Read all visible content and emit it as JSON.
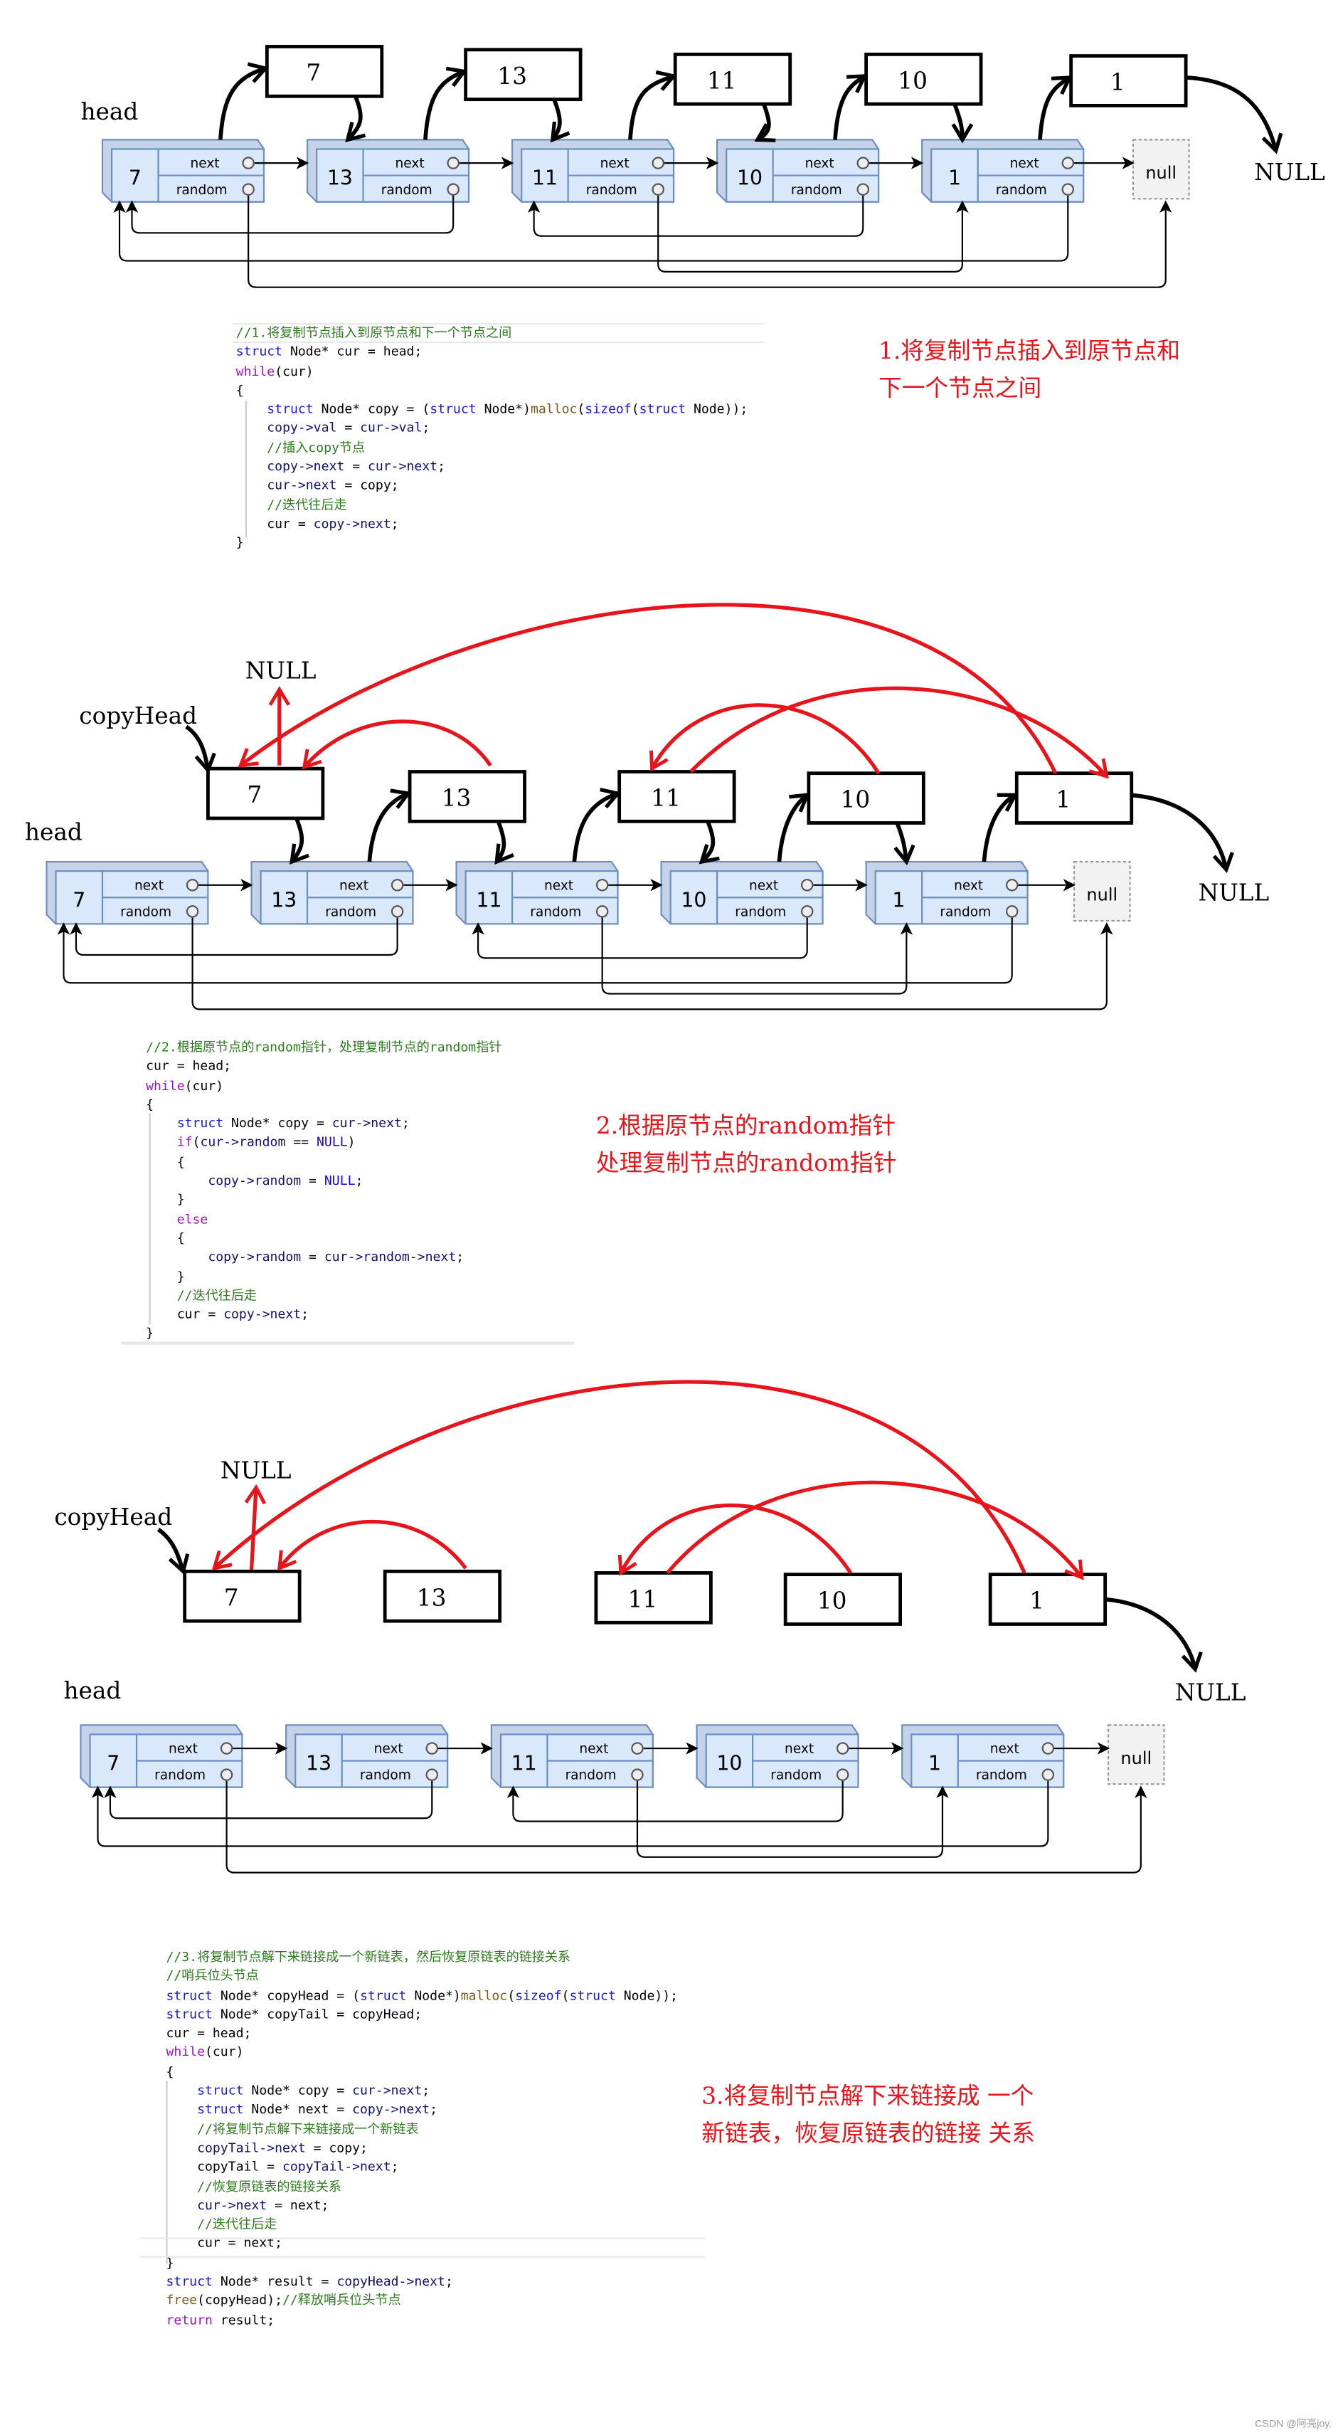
{
  "diagrams": [
    {
      "labels": {
        "head": "head",
        "null_right": "NULL",
        "null_box": "null"
      },
      "nodes": [
        "7",
        "13",
        "11",
        "10",
        "1"
      ],
      "copies": [
        "7",
        "13",
        "11",
        "10",
        "1"
      ],
      "fields": {
        "next": "next",
        "random": "random"
      }
    },
    {
      "labels": {
        "head": "head",
        "copy_head": "copyHead",
        "null_top": "NULL",
        "null_right": "NULL",
        "null_box": "null"
      },
      "nodes": [
        "7",
        "13",
        "11",
        "10",
        "1"
      ],
      "copies": [
        "7",
        "13",
        "11",
        "10",
        "1"
      ],
      "fields": {
        "next": "next",
        "random": "random"
      }
    },
    {
      "labels": {
        "head": "head",
        "copy_head": "copyHead",
        "null_top": "NULL",
        "null_right": "NULL",
        "null_box": "null"
      },
      "nodes": [
        "7",
        "13",
        "11",
        "10",
        "1"
      ],
      "copies": [
        "7",
        "13",
        "11",
        "10",
        "1"
      ],
      "fields": {
        "next": "next",
        "random": "random"
      }
    }
  ],
  "colors": {
    "node_fill": "#dae8fc",
    "node_stroke": "#6c8ebf",
    "red_arrow": "#e8141c",
    "note": "#e8141c"
  },
  "code_blocks": [
    [
      [
        [
          "cm",
          "//1.将复制节点插入到原节点和下一个节点之间"
        ]
      ],
      [
        [
          "k",
          "struct"
        ],
        [
          "n",
          " Node* cur = head;"
        ]
      ],
      [
        [
          "p",
          "while"
        ],
        [
          "n",
          "(cur)"
        ]
      ],
      [
        [
          "n",
          "{"
        ]
      ],
      [
        [
          "n",
          "    "
        ],
        [
          "k",
          "struct"
        ],
        [
          "n",
          " Node* copy = ("
        ],
        [
          "k",
          "struct"
        ],
        [
          "n",
          " Node*)"
        ],
        [
          "f",
          "malloc"
        ],
        [
          "n",
          "("
        ],
        [
          "k",
          "sizeof"
        ],
        [
          "n",
          "("
        ],
        [
          "k",
          "struct"
        ],
        [
          "n",
          " Node));"
        ]
      ],
      [
        [
          "n",
          "    "
        ],
        [
          "v",
          "copy->val"
        ],
        [
          "n",
          " = "
        ],
        [
          "v",
          "cur->val"
        ],
        [
          "n",
          ";"
        ]
      ],
      [
        [
          "n",
          "    "
        ],
        [
          "cm",
          "//插入copy节点"
        ]
      ],
      [
        [
          "n",
          "    "
        ],
        [
          "v",
          "copy->next"
        ],
        [
          "n",
          " = "
        ],
        [
          "v",
          "cur->next"
        ],
        [
          "n",
          ";"
        ]
      ],
      [
        [
          "n",
          "    "
        ],
        [
          "v",
          "cur->next"
        ],
        [
          "n",
          " = copy;"
        ]
      ],
      [
        [
          "n",
          "    "
        ],
        [
          "cm",
          "//迭代往后走"
        ]
      ],
      [
        [
          "n",
          "    cur = "
        ],
        [
          "v",
          "copy->next"
        ],
        [
          "n",
          ";"
        ]
      ],
      [
        [
          "n",
          "}"
        ]
      ]
    ],
    [
      [
        [
          "cm",
          "//2.根据原节点的random指针，处理复制节点的random指针"
        ]
      ],
      [
        [
          "n",
          "cur = head;"
        ]
      ],
      [
        [
          "p",
          "while"
        ],
        [
          "n",
          "(cur)"
        ]
      ],
      [
        [
          "n",
          "{"
        ]
      ],
      [
        [
          "n",
          "    "
        ],
        [
          "k",
          "struct"
        ],
        [
          "n",
          " Node* copy = "
        ],
        [
          "v",
          "cur->next"
        ],
        [
          "n",
          ";"
        ]
      ],
      [
        [
          "n",
          "    "
        ],
        [
          "p",
          "if"
        ],
        [
          "n",
          "("
        ],
        [
          "v",
          "cur->random"
        ],
        [
          "n",
          " == "
        ],
        [
          "m",
          "NULL"
        ],
        [
          "n",
          ")"
        ]
      ],
      [
        [
          "n",
          "    {"
        ]
      ],
      [
        [
          "n",
          "        "
        ],
        [
          "v",
          "copy->random"
        ],
        [
          "n",
          " = "
        ],
        [
          "m",
          "NULL"
        ],
        [
          "n",
          ";"
        ]
      ],
      [
        [
          "n",
          "    }"
        ]
      ],
      [
        [
          "n",
          "    "
        ],
        [
          "p",
          "else"
        ]
      ],
      [
        [
          "n",
          "    {"
        ]
      ],
      [
        [
          "n",
          "        "
        ],
        [
          "v",
          "copy->random"
        ],
        [
          "n",
          " = "
        ],
        [
          "v",
          "cur->random->next"
        ],
        [
          "n",
          ";"
        ]
      ],
      [
        [
          "n",
          "    }"
        ]
      ],
      [
        [
          "n",
          "    "
        ],
        [
          "cm",
          "//迭代往后走"
        ]
      ],
      [
        [
          "n",
          "    cur = "
        ],
        [
          "v",
          "copy->next"
        ],
        [
          "n",
          ";"
        ]
      ],
      [
        [
          "n",
          "}"
        ]
      ]
    ],
    [
      [
        [
          "cm",
          "//3.将复制节点解下来链接成一个新链表，然后恢复原链表的链接关系"
        ]
      ],
      [
        [
          "cm",
          "//哨兵位头节点"
        ]
      ],
      [
        [
          "k",
          "struct"
        ],
        [
          "n",
          " Node* copyHead = ("
        ],
        [
          "k",
          "struct"
        ],
        [
          "n",
          " Node*)"
        ],
        [
          "f",
          "malloc"
        ],
        [
          "n",
          "("
        ],
        [
          "k",
          "sizeof"
        ],
        [
          "n",
          "("
        ],
        [
          "k",
          "struct"
        ],
        [
          "n",
          " Node));"
        ]
      ],
      [
        [
          "k",
          "struct"
        ],
        [
          "n",
          " Node* copyTail = copyHead;"
        ]
      ],
      [
        [
          "n",
          "cur = head;"
        ]
      ],
      [
        [
          "p",
          "while"
        ],
        [
          "n",
          "(cur)"
        ]
      ],
      [
        [
          "n",
          "{"
        ]
      ],
      [
        [
          "n",
          "    "
        ],
        [
          "k",
          "struct"
        ],
        [
          "n",
          " Node* copy = "
        ],
        [
          "v",
          "cur->next"
        ],
        [
          "n",
          ";"
        ]
      ],
      [
        [
          "n",
          "    "
        ],
        [
          "k",
          "struct"
        ],
        [
          "n",
          " Node* next = "
        ],
        [
          "v",
          "copy->next"
        ],
        [
          "n",
          ";"
        ]
      ],
      [
        [
          "n",
          "    "
        ],
        [
          "cm",
          "//将复制节点解下来链接成一个新链表"
        ]
      ],
      [
        [
          "n",
          "    "
        ],
        [
          "v",
          "copyTail->next"
        ],
        [
          "n",
          " = copy;"
        ]
      ],
      [
        [
          "n",
          "    copyTail = "
        ],
        [
          "v",
          "copyTail->next"
        ],
        [
          "n",
          ";"
        ]
      ],
      [
        [
          "n",
          "    "
        ],
        [
          "cm",
          "//恢复原链表的链接关系"
        ]
      ],
      [
        [
          "n",
          "    "
        ],
        [
          "v",
          "cur->next"
        ],
        [
          "n",
          " = next;"
        ]
      ],
      [
        [
          "n",
          "    "
        ],
        [
          "cm",
          "//迭代往后走"
        ]
      ],
      [
        [
          "n",
          "    cur = next;"
        ]
      ],
      [
        [
          "n",
          "}"
        ]
      ],
      [
        [
          "k",
          "struct"
        ],
        [
          "n",
          " Node* result = "
        ],
        [
          "v",
          "copyHead->next"
        ],
        [
          "n",
          ";"
        ]
      ],
      [
        [
          "f",
          "free"
        ],
        [
          "n",
          "(copyHead);"
        ],
        [
          "cm",
          "//释放哨兵位头节点"
        ]
      ],
      [
        [
          "p",
          "return"
        ],
        [
          "n",
          " result;"
        ]
      ]
    ]
  ],
  "notes": [
    [
      "1.将复制节点插入到原节点和",
      "下一个节点之间"
    ],
    [
      "2.根据原节点的random指针",
      "处理复制节点的random指针"
    ],
    [
      "3.将复制节点解下来链接成 一个",
      "新链表，恢复原链表的链接 关系"
    ]
  ],
  "watermark": "CSDN @阿亮joy."
}
